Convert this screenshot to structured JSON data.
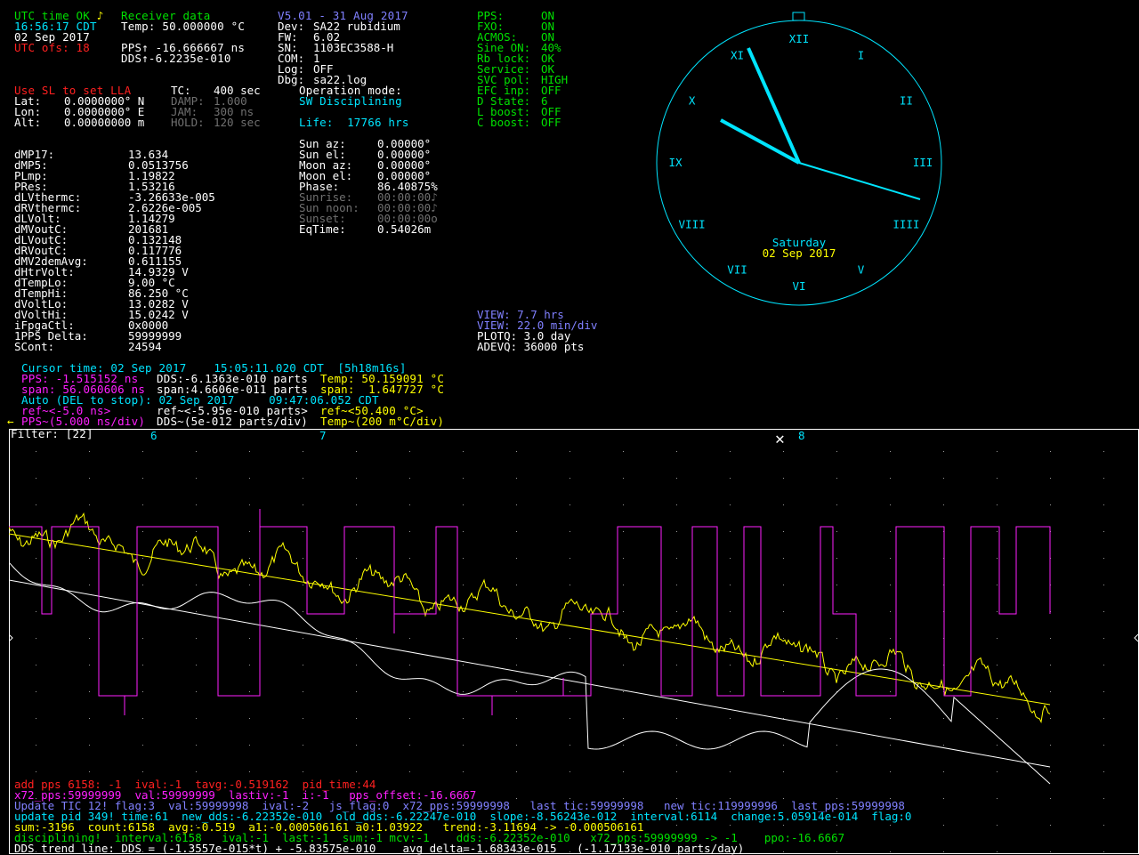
{
  "utc_status": "UTC time OK",
  "note_glyph": "♪",
  "receiver_label": "Receiver data",
  "time": "16:56:17 CDT",
  "date": "02 Sep 2017",
  "utc_offset": "UTC ofs: 18",
  "temp_line": "Temp: 50.000000 °C",
  "pps_line": "PPS↑ -16.666667 ns",
  "dds_line": "DDS↑-6.2235e-010",
  "version": "V5.01 - 31 Aug 2017",
  "device": [
    {
      "label": "Dev:",
      "value": "SA22 rubidium"
    },
    {
      "label": "FW:",
      "value": "6.02"
    },
    {
      "label": "SN:",
      "value": "1103EC3588-H"
    },
    {
      "label": "COM:",
      "value": "1"
    },
    {
      "label": "Log:",
      "value": "OFF"
    },
    {
      "label": "Dbg:",
      "value": "sa22.log"
    }
  ],
  "status_flags": [
    {
      "label": "PPS:",
      "value": "ON"
    },
    {
      "label": "FXO:",
      "value": "ON"
    },
    {
      "label": "ACMOS:",
      "value": "ON"
    },
    {
      "label": "Sine ON:",
      "value": "40%"
    },
    {
      "label": "Rb lock:",
      "value": "OK"
    },
    {
      "label": "Service:",
      "value": "OK"
    },
    {
      "label": "SVC pol:",
      "value": "HIGH"
    },
    {
      "label": "EFC inp:",
      "value": "OFF"
    },
    {
      "label": "D State:",
      "value": "6"
    },
    {
      "label": "L boost:",
      "value": "OFF"
    },
    {
      "label": "C boost:",
      "value": "OFF"
    }
  ],
  "use_sl": "Use SL to set LLA",
  "position": [
    {
      "label": "Lat:",
      "value": "0.0000000° N"
    },
    {
      "label": "Lon:",
      "value": "0.0000000° E"
    },
    {
      "label": "Alt:",
      "value": "0.00000000 m"
    }
  ],
  "tc_params": [
    {
      "label": "TC:",
      "value": "400 sec",
      "dim": false
    },
    {
      "label": "DAMP:",
      "value": "1.000",
      "dim": true
    },
    {
      "label": "JAM:",
      "value": "300 ns",
      "dim": true
    },
    {
      "label": "HOLD:",
      "value": "120 sec",
      "dim": true
    }
  ],
  "op_mode_label": "Operation mode:",
  "op_mode": "SW Disciplining",
  "life": "Life:  17766 hrs",
  "sun_moon": [
    {
      "label": "Sun az:",
      "value": "0.00000°",
      "dim": false
    },
    {
      "label": "Sun el:",
      "value": "0.00000°",
      "dim": false
    },
    {
      "label": "Moon az:",
      "value": "0.00000°",
      "dim": false
    },
    {
      "label": "Moon el:",
      "value": "0.00000°",
      "dim": false
    },
    {
      "label": "Phase:",
      "value": "86.40875%",
      "dim": false
    },
    {
      "label": "Sunrise:",
      "value": "00:00:00♪",
      "dim": true
    },
    {
      "label": "Sun noon:",
      "value": "00:00:00♪",
      "dim": true
    },
    {
      "label": "Sunset:",
      "value": "00:00:00o",
      "dim": true
    },
    {
      "label": "EqTime:",
      "value": "0.54026m",
      "dim": false
    }
  ],
  "params": [
    {
      "label": "dMP17:",
      "value": "13.634"
    },
    {
      "label": "dMP5:",
      "value": "0.0513756"
    },
    {
      "label": "PLmp:",
      "value": "1.19822"
    },
    {
      "label": "PRes:",
      "value": "1.53216"
    },
    {
      "label": "dLVthermc:",
      "value": "-3.26633e-005"
    },
    {
      "label": "dRVthermc:",
      "value": "2.6226e-005"
    },
    {
      "label": "dLVolt:",
      "value": "1.14279"
    },
    {
      "label": "dMVoutC:",
      "value": "201681"
    },
    {
      "label": "dLVoutC:",
      "value": "0.132148"
    },
    {
      "label": "dRVoutC:",
      "value": "0.117776"
    },
    {
      "label": "dMV2demAvg:",
      "value": "0.611155"
    },
    {
      "label": "dHtrVolt:",
      "value": "14.9329 V"
    },
    {
      "label": "dTempLo:",
      "value": "9.00 °C"
    },
    {
      "label": "dTempHi:",
      "value": "86.250 °C"
    },
    {
      "label": "dVoltLo:",
      "value": "13.0282 V"
    },
    {
      "label": "dVoltHi:",
      "value": "15.0242 V"
    },
    {
      "label": "iFpgaCtl:",
      "value": "0x0000"
    },
    {
      "label": "1PPS Delta:",
      "value": "59999999"
    },
    {
      "label": "SCont:",
      "value": "24594"
    }
  ],
  "clock": {
    "numerals": [
      "XII",
      "I",
      "II",
      "III",
      "IIII",
      "V",
      "VI",
      "VII",
      "VIII",
      "IX",
      "X",
      "XI"
    ],
    "day": "Saturday",
    "date": "02 Sep 2017"
  },
  "view": [
    {
      "text": "VIEW: 7.7 hrs",
      "color": "#8080ff"
    },
    {
      "text": "VIEW: 22.0 min/div",
      "color": "#8080ff"
    },
    {
      "text": "PLOTQ: 3.0 day",
      "color": "#ffffff"
    },
    {
      "text": "ADEVQ: 36000 pts",
      "color": "#ffffff"
    }
  ],
  "cursor": {
    "line1": "Cursor time: 02 Sep 2017    15:05:11.020 CDT  [5h18m16s]",
    "pps": "PPS: -1.515152 ns",
    "dds": "DDS:-6.1363e-010 parts",
    "temp": "Temp: 50.159091 °C",
    "pps_span": "span: 56.060606 ns",
    "dds_span": "span:4.6606e-011 parts",
    "temp_span": "span:  1.647727 °C",
    "auto": "Auto (DEL to stop): 02 Sep 2017     09:47:06.052 CDT",
    "pps_ref": "ref~<-5.0 ns>",
    "dds_ref": "ref~<-5.95e-010 parts>",
    "temp_ref": "ref~<50.400 °C>",
    "arrow": "←",
    "pps_scale": "PPS~(5.000 ns/div)",
    "dds_scale": "DDS~(5e-012 parts/div)",
    "temp_scale": "Temp~(200 m°C/div)"
  },
  "filter": "Filter: [22]",
  "markers": [
    "6",
    "7",
    "8"
  ],
  "close_glyph": "✕",
  "debug": [
    {
      "text": "add pps 6158: -1  ival:-1  tavg:-0.519162  pid_time:44",
      "color": "#ff2020"
    },
    {
      "text": "x72_pps:59999999  val:59999999  lastiv:-1  i:-1   pps_offset:-16.6667",
      "color": "#ff20ff"
    },
    {
      "text": "Update TIC 12! flag:3  val:59999998  ival:-2   js_flag:0  x72_pps:59999998   last tic:59999998   new tic:119999996  last_pps:59999998",
      "color": "#8080ff"
    },
    {
      "text": "update pid 349! time:61  new_dds:-6.22352e-010  old_dds:-6.22247e-010  slope:-8.56243e-012  interval:6114  change:5.05914e-014  flag:0",
      "color": "#00e5ff"
    },
    {
      "text": "sum:-3196  count:6158  avg:-0.519  a1:-0.000506161 a0:1.03922   trend:-3.11694 -> -0.000506161",
      "color": "#ffff00"
    },
    {
      "text": "disciplining!  interval:6158   ival:-1  last:-1  sum:-1 mcv:-1    dds:-6.22352e-010   x72_pps:59999999 -> -1    ppo:-16.6667",
      "color": "#00e000"
    },
    {
      "text": "DDS trend line: DDS = (-1.3557e-015*t) + -5.83575e-010    avg delta=-1.68343e-015   (-1.17133e-010 parts/day)",
      "color": "#ffffff"
    }
  ]
}
